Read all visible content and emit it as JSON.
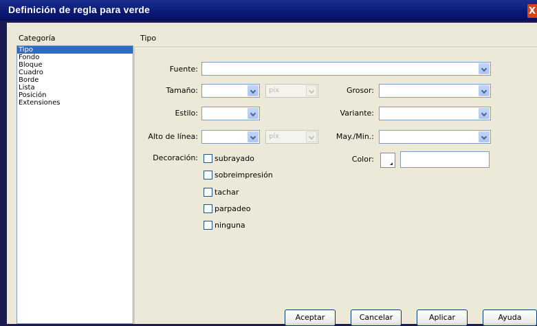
{
  "window": {
    "title": "Definición de regla para verde",
    "close_glyph": "X"
  },
  "category_header": "Categoría",
  "section_header": "Tipo",
  "categories": [
    "Tipo",
    "Fondo",
    "Bloque",
    "Cuadro",
    "Borde",
    "Lista",
    "Posición",
    "Extensiones"
  ],
  "selected_category": "Tipo",
  "fields": {
    "fuente": {
      "label": "Fuente:",
      "value": ""
    },
    "tamano": {
      "label": "Tamaño:",
      "value": "",
      "unit": "píx"
    },
    "grosor": {
      "label": "Grosor:",
      "value": ""
    },
    "estilo": {
      "label": "Estilo:",
      "value": ""
    },
    "variante": {
      "label": "Variante:",
      "value": ""
    },
    "alto_linea": {
      "label": "Alto de línea:",
      "value": "",
      "unit": "píx"
    },
    "may_min": {
      "label": "May./Min.:",
      "value": ""
    },
    "decoracion": {
      "label": "Decoración:"
    },
    "color": {
      "label": "Color:",
      "value": ""
    }
  },
  "decorations": [
    {
      "label": "subrayado",
      "checked": false
    },
    {
      "label": "sobreimpresión",
      "checked": false
    },
    {
      "label": "tachar",
      "checked": false
    },
    {
      "label": "parpadeo",
      "checked": false
    },
    {
      "label": "ninguna",
      "checked": false
    }
  ],
  "buttons": {
    "accept": "Aceptar",
    "cancel": "Cancelar",
    "apply": "Aplicar",
    "help": "Ayuda"
  },
  "colors": {
    "selection": "#316ac5",
    "titlebar": "#0a1a77",
    "dialog_bg": "#ece9d8"
  }
}
